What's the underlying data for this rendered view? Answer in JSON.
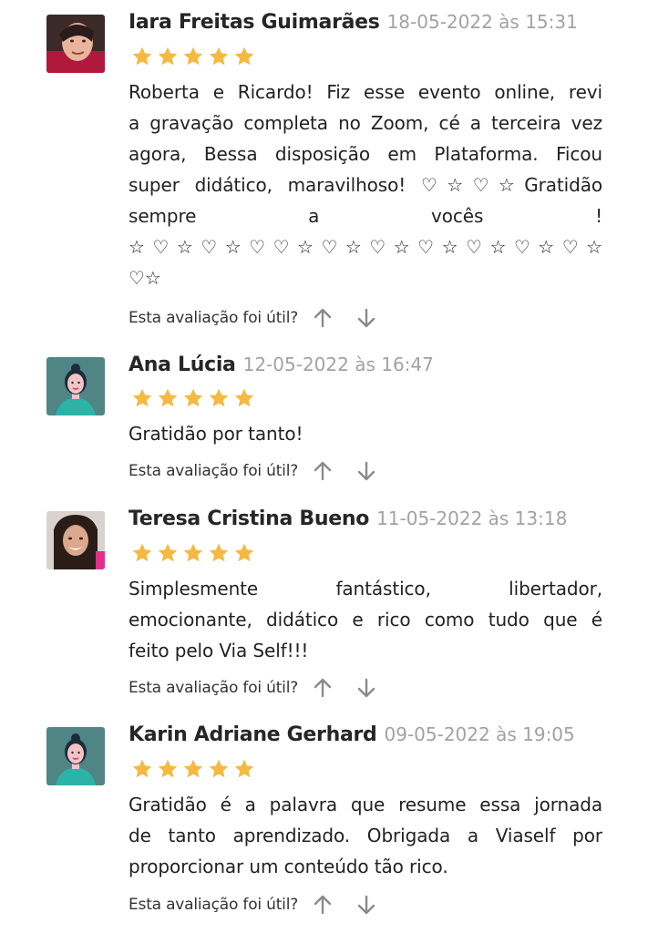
{
  "feedback_label": "Esta avaliação foi útil?",
  "star_color": "#f5b942",
  "reviews": [
    {
      "author": "Iara Freitas Guimarães",
      "date": "18-05-2022 às 15:31",
      "rating": 5,
      "avatar": "photo",
      "text_lines": [
        "Roberta e Ricardo! Fiz esse evento online, revi",
        "a gravação completa no Zoom, cé a terceira vez",
        "agora, Bessa disposição em Plataforma. Ficou",
        "super didático, maravilhoso! ♡☆♡☆Gratidão",
        "sempre a vocês !",
        "☆♡☆♡☆♡♡☆♡☆♡☆♡☆♡☆♡☆♡☆",
        "♡☆"
      ]
    },
    {
      "author": "Ana Lúcia",
      "date": "12-05-2022 às 16:47",
      "rating": 5,
      "avatar": "placeholder-person-icon",
      "text_lines": [
        "Gratidão por tanto!"
      ]
    },
    {
      "author": "Teresa Cristina Bueno",
      "date": "11-05-2022 às 13:18",
      "rating": 5,
      "avatar": "photo",
      "text_lines": [
        "Simplesmente fantástico, libertador,",
        "emocionante, didático e rico como tudo que é",
        "feito pelo Via Self!!!"
      ]
    },
    {
      "author": "Karin Adriane Gerhard",
      "date": "09-05-2022 às 19:05",
      "rating": 5,
      "avatar": "placeholder-person-icon",
      "text_lines": [
        "Gratidão é a palavra que resume essa jornada",
        "de tanto aprendizado. Obrigada a Viaself por",
        "proporcionar um conteúdo tão rico."
      ]
    }
  ]
}
